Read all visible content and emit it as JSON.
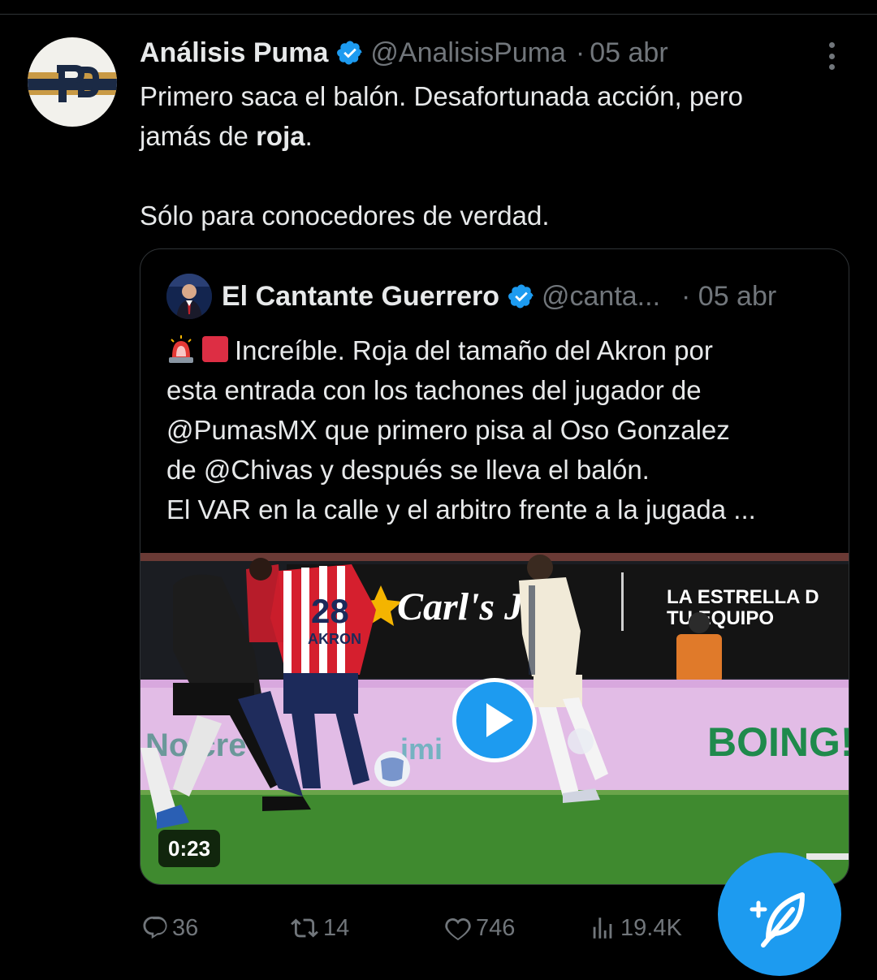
{
  "tweet": {
    "author_name": "Análisis Puma",
    "handle": "@AnalisisPuma",
    "separator": "·",
    "date": "05 abr",
    "text_line1_part1": "Primero saca el balón. Desafortunada acción, pero",
    "text_line2_part1": "jamás de ",
    "text_line2_bold": "roja",
    "text_line2_end": ".",
    "text_line3": "Sólo para conocedores de verdad."
  },
  "quote": {
    "author_name": "El Cantante Guerrero",
    "handle": "@canta...",
    "date": "· 05 abr",
    "lines": [
      "Increíble. Roja del tamaño del Akron por",
      "esta entrada con los tachones del jugador de",
      "@PumasMX que primero pisa al Oso Gonzalez",
      "de @Chivas y después se lleva el balón.",
      "El VAR en la calle y el arbitro frente a la jugada ..."
    ],
    "video": {
      "duration": "0:23",
      "sponsor_text": "Carl's Jr.",
      "banner_line1": "LA ESTRELLA D",
      "banner_line2": "TU EQUIPO",
      "player_number": "28",
      "shirt_sponsor": "AKRON",
      "board_text": "BOING!"
    }
  },
  "actions": {
    "replies": "36",
    "reposts": "14",
    "likes": "746",
    "views": "19.4K"
  },
  "colors": {
    "accent": "#1d9bf0",
    "text": "#e7e9ea",
    "muted": "#71767b",
    "border": "#2f3336",
    "background": "#000000"
  },
  "icons": [
    "verified-badge-icon",
    "more-options-icon",
    "reply-icon",
    "repost-icon",
    "like-icon",
    "views-icon",
    "play-icon",
    "compose-post-icon",
    "siren-emoji-icon",
    "red-square-emoji-icon"
  ]
}
